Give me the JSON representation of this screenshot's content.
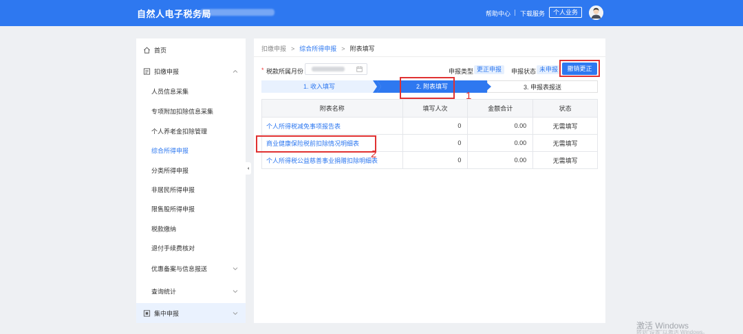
{
  "header": {
    "brand": "自然人电子税务局",
    "nav": [
      {
        "label": "帮助中心"
      },
      {
        "label": "下载服务"
      }
    ],
    "personal_button": "个人业务"
  },
  "sidebar": {
    "items": [
      {
        "label": "首页",
        "icon": "home-icon",
        "top_level": true
      },
      {
        "label": "扣缴申报",
        "icon": "declare-icon",
        "top_level": true,
        "expanded": true
      },
      {
        "label": "人员信息采集"
      },
      {
        "label": "专项附加扣除信息采集"
      },
      {
        "label": "个人养老金扣除管理"
      },
      {
        "label": "综合所得申报",
        "active": true
      },
      {
        "label": "分类所得申报"
      },
      {
        "label": "非居民所得申报"
      },
      {
        "label": "限售股所得申报"
      },
      {
        "label": "税款缴纳"
      },
      {
        "label": "退付手续费核对"
      },
      {
        "label": "优惠备案与信息报送",
        "has_children": true
      },
      {
        "label": "查询统计",
        "has_children": true
      }
    ],
    "bottom_item": {
      "label": "集中申报",
      "icon": "centralized-icon"
    }
  },
  "breadcrumb": {
    "items": [
      "扣缴申报",
      "综合所得申报",
      "附表填写"
    ],
    "separator": ">"
  },
  "form": {
    "period_label": "税款所属月份",
    "declare_type_label": "申报类型",
    "declare_type_value": "更正申报",
    "status_label": "申报状态",
    "status_value": "未申报",
    "revoke_button": "撤销更正"
  },
  "steps": [
    {
      "label": "1. 收入填写",
      "state": "done"
    },
    {
      "label": "2. 附表填写",
      "state": "current"
    },
    {
      "label": "3. 申报表报送",
      "state": "pending"
    }
  ],
  "table": {
    "headers": [
      "附表名称",
      "填写人次",
      "金额合计",
      "状态"
    ],
    "rows": [
      {
        "name": "个人所得税减免事项报告表",
        "count": "0",
        "amount": "0.00",
        "status": "无需填写"
      },
      {
        "name": "商业健康保险税前扣除情况明细表",
        "count": "0",
        "amount": "0.00",
        "status": "无需填写"
      },
      {
        "name": "个人所得税公益慈善事业捐赠扣除明细表",
        "count": "0",
        "amount": "0.00",
        "status": "无需填写"
      }
    ]
  },
  "annotations": {
    "num1": "1",
    "num2": "2",
    "color": "#e03030"
  },
  "watermark": {
    "line1": "激活 Windows",
    "line2": "转到\"设置\"以激活 Windows。"
  },
  "colors": {
    "primary": "#2e78f0",
    "link": "#2e78f0",
    "required": "#e33333"
  }
}
